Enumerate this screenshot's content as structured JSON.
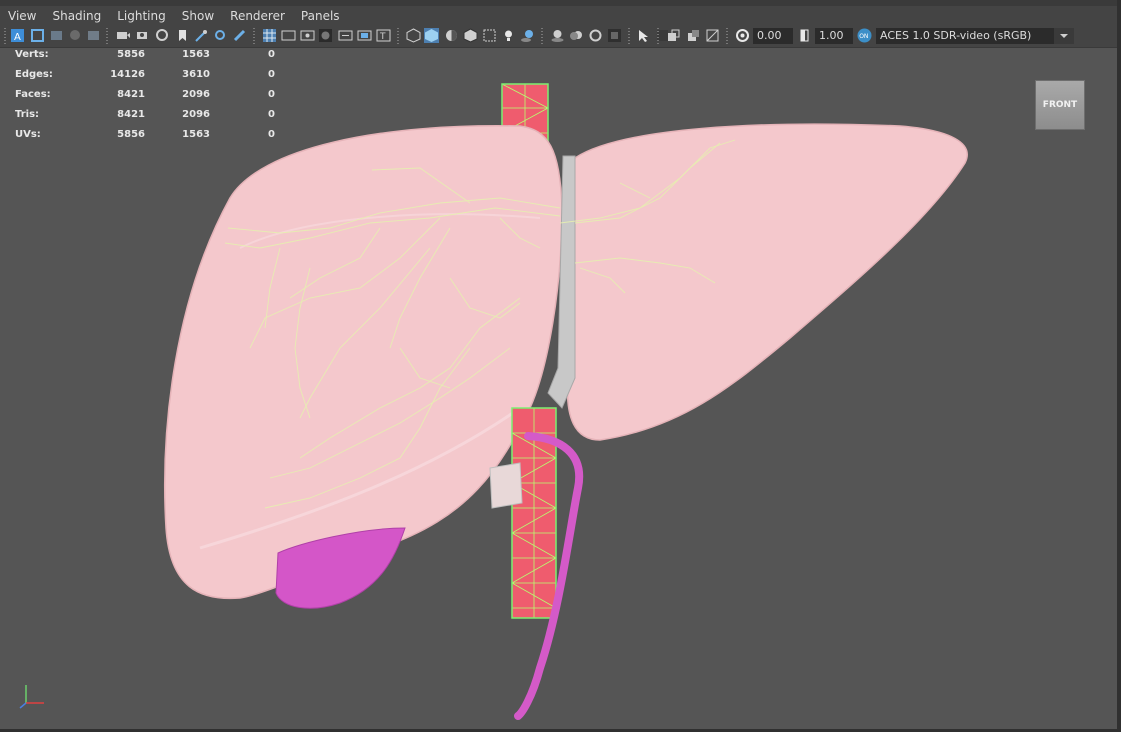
{
  "menu": [
    "View",
    "Shading",
    "Lighting",
    "Show",
    "Renderer",
    "Panels"
  ],
  "toolbar": {
    "exposure": "0.00",
    "gamma": "1.00",
    "colorspace": "ACES 1.0 SDR-video (sRGB)"
  },
  "hud": {
    "rows": [
      {
        "label": "Verts:",
        "v1": "5856",
        "v2": "1563",
        "v3": "0"
      },
      {
        "label": "Edges:",
        "v1": "14126",
        "v2": "3610",
        "v3": "0"
      },
      {
        "label": "Faces:",
        "v1": "8421",
        "v2": "2096",
        "v3": "0"
      },
      {
        "label": "Tris:",
        "v1": "8421",
        "v2": "2096",
        "v3": "0"
      },
      {
        "label": "UVs:",
        "v1": "5856",
        "v2": "1563",
        "v3": "0"
      }
    ]
  },
  "viewcube": {
    "label": "FRONT"
  },
  "colors": {
    "viewport_bg": "#555555",
    "liver": "#f2c4c8",
    "vessel": "#f06070",
    "wire": "#b8ff70",
    "gallbladder": "#d45ac8",
    "ligament": "#c8c8c8"
  }
}
